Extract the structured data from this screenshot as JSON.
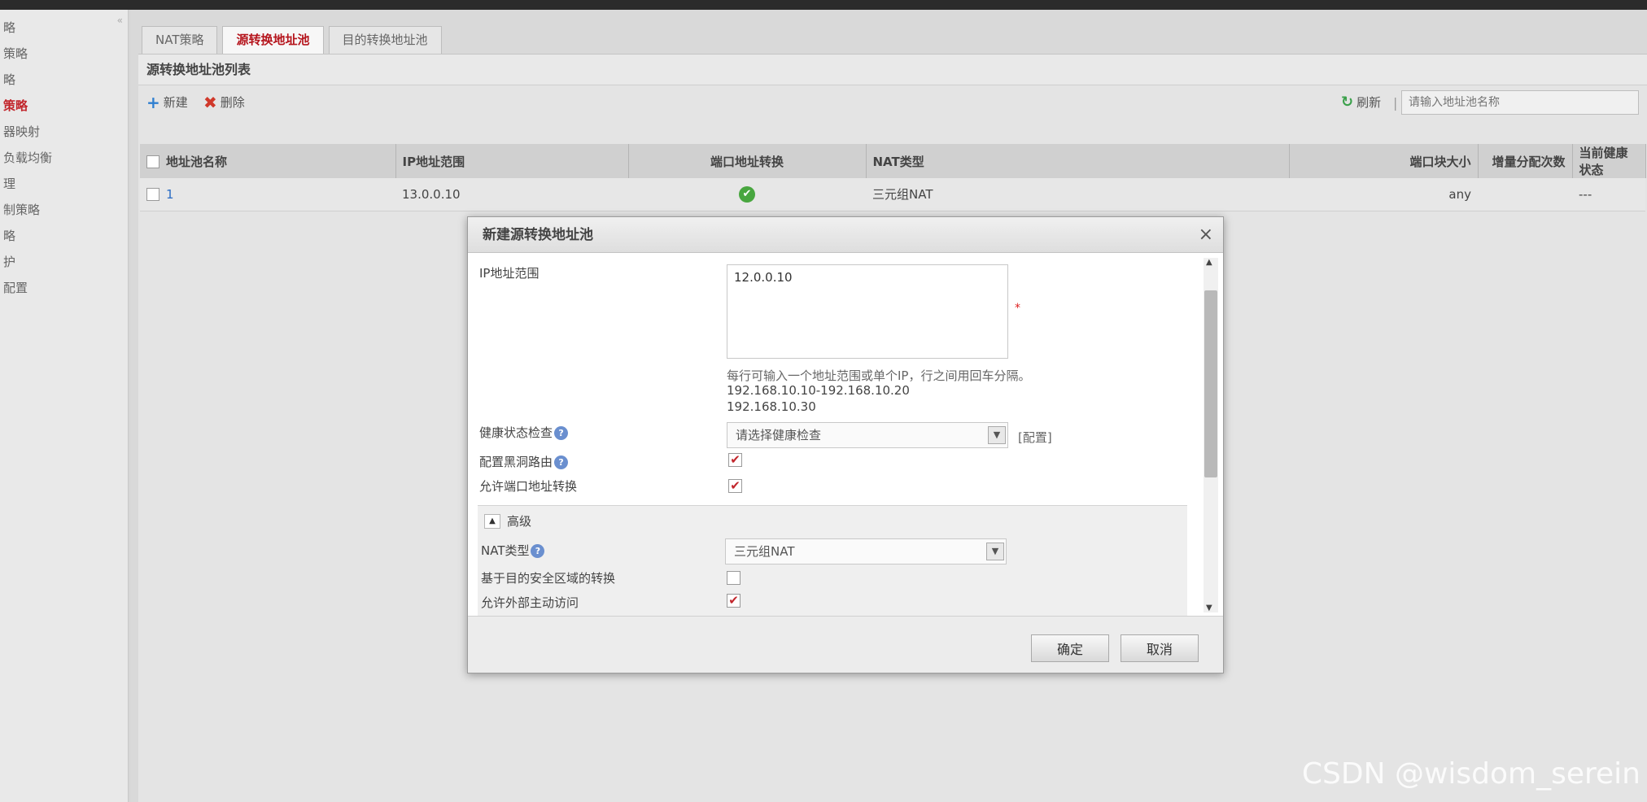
{
  "sidebar": {
    "collapse_label": "«",
    "items": [
      {
        "label": "略",
        "active": false
      },
      {
        "label": "策略",
        "active": false
      },
      {
        "label": "略",
        "active": false
      },
      {
        "label": "策略",
        "active": true
      },
      {
        "label": "器映射",
        "active": false
      },
      {
        "label": "负载均衡",
        "active": false
      },
      {
        "label": "理",
        "active": false
      },
      {
        "label": "制策略",
        "active": false
      },
      {
        "label": "略",
        "active": false
      },
      {
        "label": "护",
        "active": false
      },
      {
        "label": "配置",
        "active": false
      }
    ]
  },
  "tabs": [
    {
      "label": "NAT策略",
      "active": false
    },
    {
      "label": "源转换地址池",
      "active": true
    },
    {
      "label": "目的转换地址池",
      "active": false
    }
  ],
  "panel": {
    "title": "源转换地址池列表"
  },
  "toolbar": {
    "add_icon": "+",
    "add_label": "新建",
    "delete_icon": "✖",
    "delete_label": "删除",
    "refresh_icon": "↻",
    "refresh_label": "刷新",
    "separator": "|",
    "search_placeholder": "请输入地址池名称"
  },
  "table": {
    "columns": [
      "地址池名称",
      "IP地址范围",
      "端口地址转换",
      "NAT类型",
      "端口块大小",
      "增量分配次数",
      "当前健康状态"
    ],
    "rows": [
      {
        "name": "1",
        "ip_range": "13.0.0.10",
        "port_translation": "✔",
        "nat_type": "三元组NAT",
        "port_block_size": "any",
        "increment_count": "",
        "health_status": "---"
      }
    ]
  },
  "modal": {
    "title": "新建源转换地址池",
    "close_icon": "×",
    "ip_range_label": "IP地址范围",
    "ip_range_value": "12.0.0.10",
    "required_mark": "*",
    "hint_line1": "每行可输入一个地址范围或单个IP，行之间用回车分隔。",
    "hint_line2": "192.168.10.10-192.168.10.20",
    "hint_line3": "192.168.10.30",
    "health_check_label": "健康状态检查",
    "health_check_placeholder": "请选择健康检查",
    "config_link": "[配置]",
    "help_icon": "?",
    "blackhole_label": "配置黑洞路由",
    "blackhole_checked": true,
    "allow_port_label": "允许端口地址转换",
    "allow_port_checked": true,
    "advanced_label": "高级",
    "advanced_toggle": "▲",
    "nat_type_label": "NAT类型",
    "nat_type_value": "三元组NAT",
    "dest_zone_label": "基于目的安全区域的转换",
    "dest_zone_checked": false,
    "allow_external_label": "允许外部主动访问",
    "allow_external_checked": true,
    "check_mark": "✔",
    "select_arrow": "▼",
    "scroll_up": "▲",
    "scroll_down": "▼",
    "ok_label": "确定",
    "cancel_label": "取消"
  },
  "watermark": "CSDN @wisdom_serein"
}
